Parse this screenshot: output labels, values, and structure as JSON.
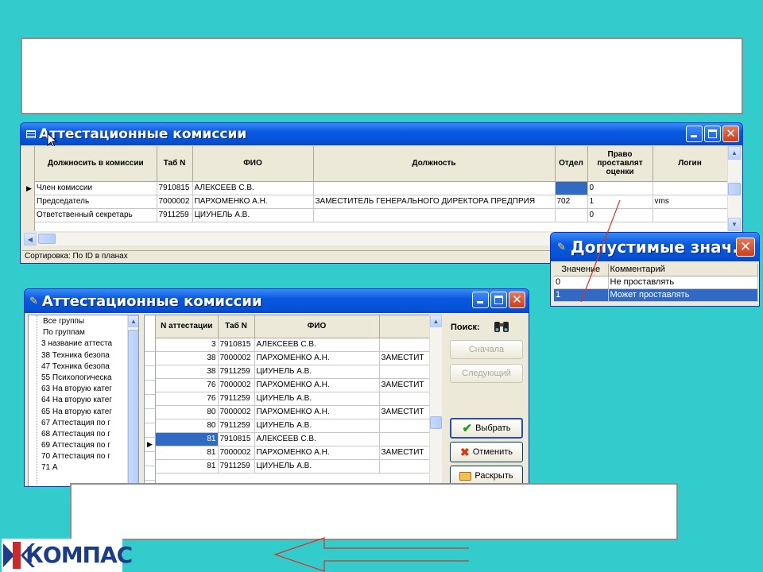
{
  "win1": {
    "title": "Аттестационные комиссии",
    "columns": [
      "Должносить в комиссии",
      "Таб N",
      "ФИО",
      "Должность",
      "Отдел",
      "Право проставлят оценки",
      "Логин"
    ],
    "rows": [
      [
        "Член комиссии",
        "7910815",
        "АЛЕКСЕЕВ С.В.",
        "",
        "",
        "0",
        ""
      ],
      [
        "Председатель",
        "7000002",
        "ПАРХОМЕНКО А.Н.",
        "ЗАМЕСТИТЕЛЬ ГЕНЕРАЛЬНОГО ДИРЕКТОРА ПРЕДПРИЯ",
        "702",
        "1",
        "vms"
      ],
      [
        "Ответственный секретарь",
        "7911259",
        "ЦИУНЕЛЬ А.В.",
        "",
        "",
        "0",
        ""
      ]
    ],
    "status": "Сортировка: По ID в планах"
  },
  "popup": {
    "title": "Допустимые знач...",
    "columns": [
      "Значение",
      "Комментарий"
    ],
    "rows": [
      [
        "0",
        "Не проставлять"
      ],
      [
        "1",
        "Может проставлять"
      ]
    ]
  },
  "win2": {
    "title": "Аттестационные комиссии",
    "tree": [
      "Все группы",
      "По группам",
      "3  название аттеста",
      "38  Техника безопа",
      "47  Техника безопа",
      "55  Психологическа",
      "63  На вторую катег",
      "64  На вторую катег",
      "65  На вторую катег",
      "67  Аттестация по г",
      "68  Аттестация по г",
      "69  Аттестация по г",
      "70  Аттестация по г",
      "71  А"
    ],
    "columns": [
      "N аттестации",
      "Таб N",
      "ФИО",
      ""
    ],
    "rows": [
      [
        "3",
        "7910815",
        "АЛЕКСЕЕВ С.В.",
        ""
      ],
      [
        "38",
        "7000002",
        "ПАРХОМЕНКО А.Н.",
        "ЗАМЕСТИТ"
      ],
      [
        "38",
        "7911259",
        "ЦИУНЕЛЬ А.В.",
        ""
      ],
      [
        "76",
        "7000002",
        "ПАРХОМЕНКО А.Н.",
        "ЗАМЕСТИТ"
      ],
      [
        "76",
        "7911259",
        "ЦИУНЕЛЬ А.В.",
        ""
      ],
      [
        "80",
        "7000002",
        "ПАРХОМЕНКО А.Н.",
        "ЗАМЕСТИТ"
      ],
      [
        "80",
        "7911259",
        "ЦИУНЕЛЬ А.В.",
        ""
      ],
      [
        "81",
        "7910815",
        "АЛЕКСЕЕВ С.В.",
        ""
      ],
      [
        "81",
        "7000002",
        "ПАРХОМЕНКО А.Н.",
        "ЗАМЕСТИТ"
      ],
      [
        "81",
        "7911259",
        "ЦИУНЕЛЬ А.В.",
        ""
      ]
    ],
    "search_label": "Поиск:",
    "btn_first": "Сначала",
    "btn_next": "Следующий",
    "btn_select": "Выбрать",
    "btn_cancel": "Отменить",
    "btn_expand": "Раскрыть"
  },
  "logo": "КОМПАС"
}
